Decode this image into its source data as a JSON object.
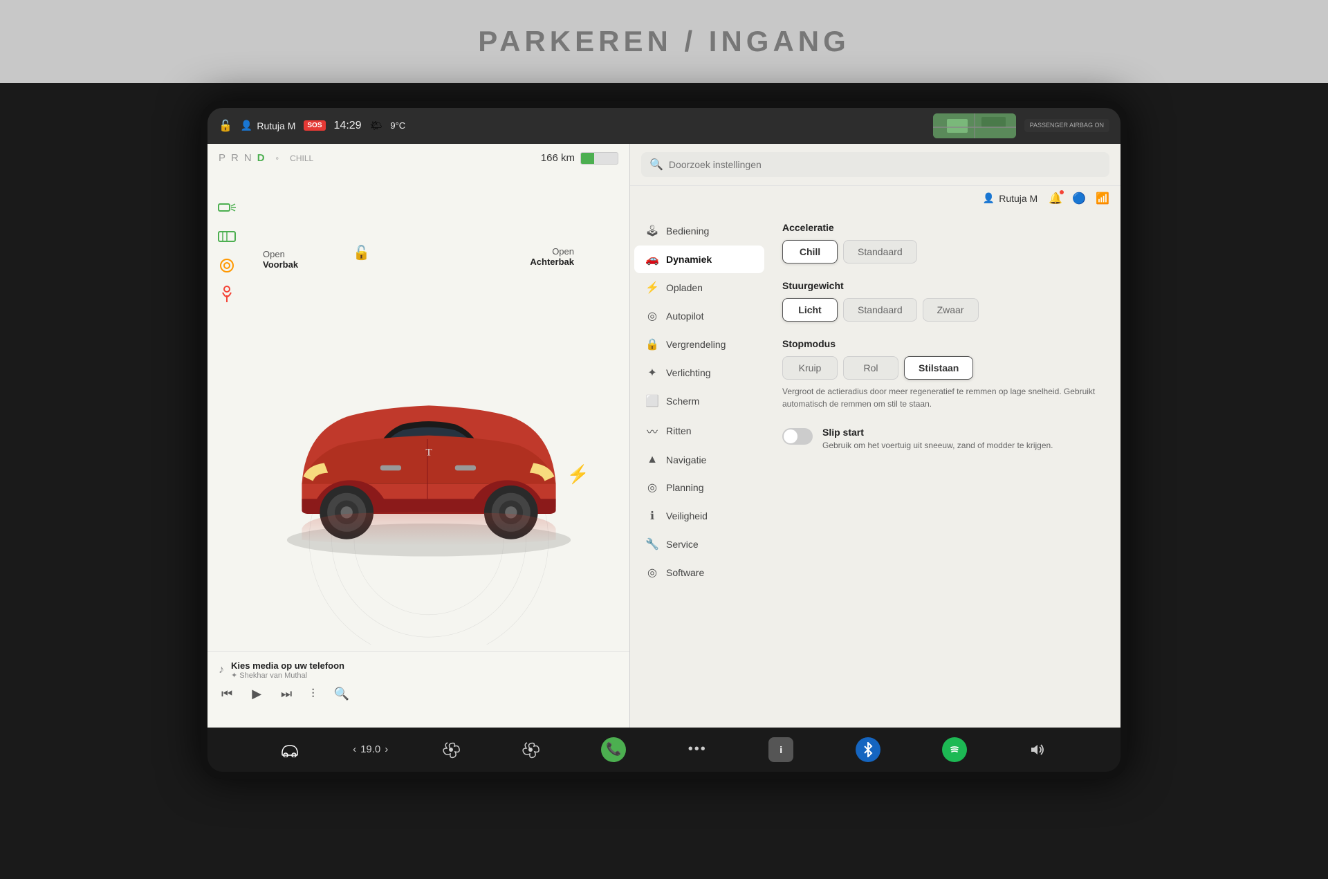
{
  "background": {
    "parking_sign": "PARKEREN / INGANG"
  },
  "topbar": {
    "user": "Rutuja M",
    "sos": "SOS",
    "time": "14:29",
    "weather": "9°C",
    "passenger_airbag": "PASSENGER\nAIRBAG ON"
  },
  "left_panel": {
    "prnd": {
      "p": "P",
      "r": "R",
      "n": "N",
      "d": "D",
      "active": "D",
      "mode": "CHILL"
    },
    "range": "166 km",
    "labels": {
      "open_voorbak": "Open",
      "voorbak": "Voorbak",
      "open_achterbak": "Open",
      "achterbak": "Achterbak"
    },
    "media": {
      "title": "Kies media op uw telefoon",
      "artist": "✦ Shekhar van Muthal"
    }
  },
  "search": {
    "placeholder": "Doorzoek instellingen"
  },
  "userbar": {
    "name": "Rutuja M"
  },
  "menu": {
    "items": [
      {
        "id": "bediening",
        "icon": "🕹",
        "label": "Bediening",
        "active": false
      },
      {
        "id": "dynamiek",
        "icon": "🚗",
        "label": "Dynamiek",
        "active": true
      },
      {
        "id": "opladen",
        "icon": "⚡",
        "label": "Opladen",
        "active": false
      },
      {
        "id": "autopilot",
        "icon": "◎",
        "label": "Autopilot",
        "active": false
      },
      {
        "id": "vergrendeling",
        "icon": "🔒",
        "label": "Vergrendeling",
        "active": false
      },
      {
        "id": "verlichting",
        "icon": "✦",
        "label": "Verlichting",
        "active": false
      },
      {
        "id": "scherm",
        "icon": "⬜",
        "label": "Scherm",
        "active": false
      },
      {
        "id": "ritten",
        "icon": "〰",
        "label": "Ritten",
        "active": false
      },
      {
        "id": "navigatie",
        "icon": "▲",
        "label": "Navigatie",
        "active": false
      },
      {
        "id": "planning",
        "icon": "◎",
        "label": "Planning",
        "active": false
      },
      {
        "id": "veiligheid",
        "icon": "ℹ",
        "label": "Veiligheid",
        "active": false
      },
      {
        "id": "service",
        "icon": "🔧",
        "label": "Service",
        "active": false
      },
      {
        "id": "software",
        "icon": "◎",
        "label": "Software",
        "active": false
      }
    ]
  },
  "settings": {
    "acceleratie": {
      "title": "Acceleratie",
      "buttons": [
        {
          "label": "Chill",
          "active": true
        },
        {
          "label": "Standaard",
          "active": false
        }
      ]
    },
    "stuurgewicht": {
      "title": "Stuurgewicht",
      "buttons": [
        {
          "label": "Licht",
          "active": true
        },
        {
          "label": "Standaard",
          "active": false
        },
        {
          "label": "Zwaar",
          "active": false
        }
      ]
    },
    "stopmodus": {
      "title": "Stopmodus",
      "buttons": [
        {
          "label": "Kruip",
          "active": false
        },
        {
          "label": "Rol",
          "active": false
        },
        {
          "label": "Stilstaan",
          "active": true
        }
      ],
      "description": "Vergroot de actieradius door meer regeneratief te remmen op lage snelheid. Gebruikt automatisch de remmen om stil te staan."
    },
    "slip_start": {
      "title": "Slip start",
      "description": "Gebruik om het voertuig uit sneeuw, zand of modder te krijgen.",
      "enabled": false
    }
  },
  "taskbar": {
    "temp": "19.0",
    "items": [
      {
        "id": "car",
        "label": "Car"
      },
      {
        "id": "fan1",
        "label": "Fan"
      },
      {
        "id": "fan2",
        "label": "Fan 2"
      },
      {
        "id": "phone",
        "label": "Phone"
      },
      {
        "id": "dots",
        "label": "More"
      },
      {
        "id": "info",
        "label": "Info"
      },
      {
        "id": "bluetooth",
        "label": "Bluetooth"
      },
      {
        "id": "spotify",
        "label": "Spotify"
      },
      {
        "id": "volume",
        "label": "Volume"
      }
    ]
  }
}
